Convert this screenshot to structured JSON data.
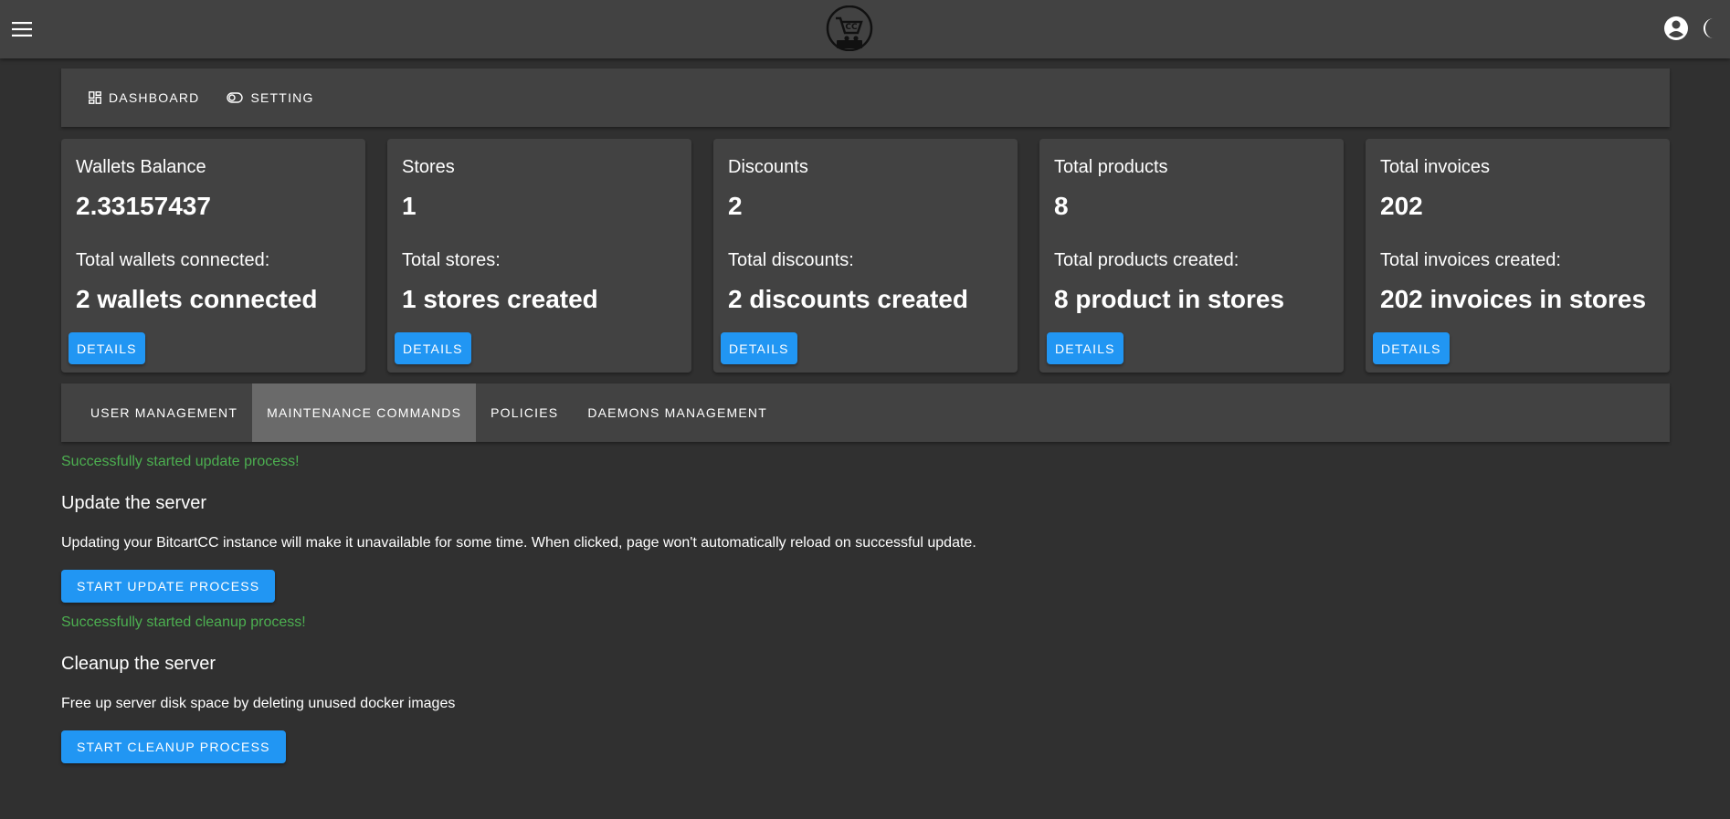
{
  "topbar": {
    "menu_icon": "hamburger-menu-icon",
    "logo_icon": "bitcartcc-logo",
    "account_icon": "account-circle-icon",
    "theme_icon": "moon-icon"
  },
  "nav": {
    "items": [
      {
        "label": "DASHBOARD",
        "icon": "dashboard-icon"
      },
      {
        "label": "SETTING",
        "icon": "toggle-icon"
      }
    ]
  },
  "cards": [
    {
      "title": "Wallets Balance",
      "value": "2.33157437",
      "subtitle": "Total wallets connected:",
      "subvalue": "2 wallets connected",
      "button": "DETAILS"
    },
    {
      "title": "Stores",
      "value": "1",
      "subtitle": "Total stores:",
      "subvalue": "1 stores created",
      "button": "DETAILS"
    },
    {
      "title": "Discounts",
      "value": "2",
      "subtitle": "Total discounts:",
      "subvalue": "2 discounts created",
      "button": "DETAILS"
    },
    {
      "title": "Total products",
      "value": "8",
      "subtitle": "Total products created:",
      "subvalue": "8 product in stores",
      "button": "DETAILS"
    },
    {
      "title": "Total invoices",
      "value": "202",
      "subtitle": "Total invoices created:",
      "subvalue": "202 invoices in stores",
      "button": "DETAILS"
    }
  ],
  "tabs": [
    {
      "label": "USER MANAGEMENT",
      "active": false
    },
    {
      "label": "MAINTENANCE COMMANDS",
      "active": true
    },
    {
      "label": "POLICIES",
      "active": false
    },
    {
      "label": "DAEMONS MANAGEMENT",
      "active": false
    }
  ],
  "maintenance": {
    "update": {
      "status": "Successfully started update process!",
      "title": "Update the server",
      "description": "Updating your BitcartCC instance will make it unavailable for some time. When clicked, page won't automatically reload on successful update.",
      "button": "START UPDATE PROCESS"
    },
    "cleanup": {
      "status": "Successfully started cleanup process!",
      "title": "Cleanup the server",
      "description": "Free up server disk space by deleting unused docker images",
      "button": "START CLEANUP PROCESS"
    }
  },
  "colors": {
    "background": "#303030",
    "surface": "#424242",
    "primary": "#2196f3",
    "success": "#4caf50",
    "active_tab": "#6a6a6a"
  }
}
